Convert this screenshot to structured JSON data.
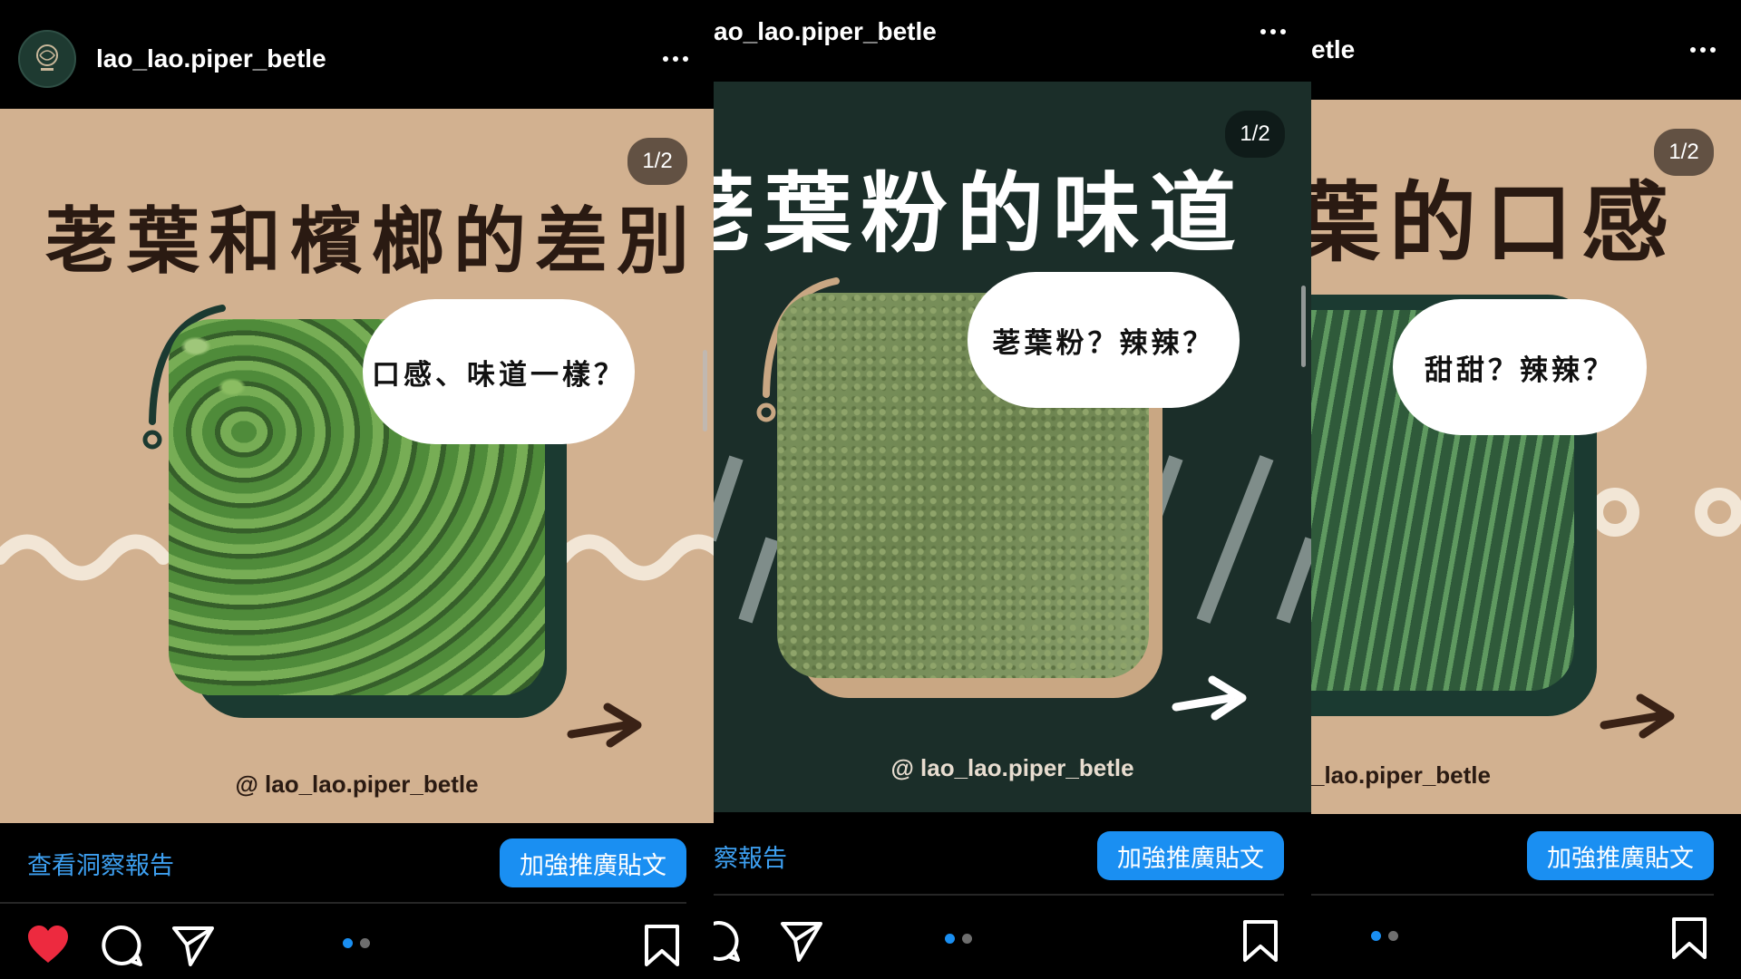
{
  "panels": [
    {
      "username": "lao_lao.piper_betle",
      "slide_counter": "1/2",
      "headline": "荖葉和檳榔的差別",
      "bubble_text": "口感、味道一樣？",
      "handle": "@ lao_lao.piper_betle",
      "insights_link": "查看洞察報告",
      "boost_button": "加強推廣貼文",
      "liked": true,
      "carousel": {
        "current": 1,
        "total": 2
      }
    },
    {
      "username": "ao_lao.piper_betle",
      "slide_counter": "1/2",
      "headline": "荖葉粉的味道",
      "bubble_text": "荖葉粉？辣辣？",
      "handle": "@ lao_lao.piper_betle",
      "insights_link": "察報告",
      "boost_button": "加強推廣貼文",
      "carousel": {
        "current": 1,
        "total": 2
      }
    },
    {
      "username": "etle",
      "slide_counter": "1/2",
      "headline": "葉的口感",
      "bubble_text": "甜甜？辣辣？",
      "handle": "_lao.piper_betle",
      "boost_button": "加強推廣貼文",
      "carousel": {
        "current": 1,
        "total": 2
      }
    }
  ],
  "icons": {
    "like": "heart-icon",
    "comment": "comment-icon",
    "share": "send-icon",
    "save": "bookmark-icon",
    "more": "more-options-icon"
  },
  "colors": {
    "tan_bg": "#d2b190",
    "dark_green": "#1b2e29",
    "headline_dark": "#2a1a12",
    "link_blue": "#3d9ff0",
    "button_blue": "#1a8ff2",
    "heart_red": "#ed2a3f"
  }
}
